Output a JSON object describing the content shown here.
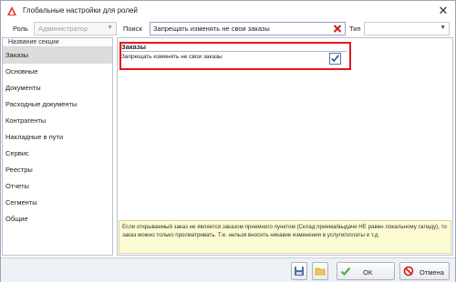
{
  "window": {
    "title": "Глобальные настройки для ролей",
    "close_glyph": "✕"
  },
  "filters": {
    "role_label": "Роль",
    "role_value": "Администратор",
    "search_label": "Поиск",
    "search_value": "Запрещать изменять не свои заказы",
    "type_label": "Тип",
    "type_value": ""
  },
  "sidebar": {
    "header": "Название секции",
    "items": [
      {
        "label": "Заказы",
        "selected": true
      },
      {
        "label": "Основные"
      },
      {
        "label": "Документы"
      },
      {
        "label": "Расходные документы"
      },
      {
        "label": "Контрагенты"
      },
      {
        "label": "Накладные в пути"
      },
      {
        "label": "Сервис"
      },
      {
        "label": "Реестры"
      },
      {
        "label": "Отчеты"
      },
      {
        "label": "Сегменты"
      },
      {
        "label": "Общие"
      }
    ]
  },
  "settings": {
    "group_title": "Заказы",
    "option_label": "Запрещать изменять не свои заказы",
    "option_checked": true,
    "description": "Если открываемый заказ не является заказом приемного пунктом (Склад приема/выдачи НЕ равен локальному складу), то заказ можно только просматривать. Т.е. нельзя вносить никакие изменения в услуги/оплаты и т.д."
  },
  "buttons": {
    "ok": "ОК",
    "cancel": "Отмена"
  },
  "colors": {
    "highlight": "#e4161c",
    "selected_bg": "#dcdcdc",
    "description_bg": "#fdfbd2",
    "ok_check": "#4caf50",
    "cancel_icon": "#d21c1c"
  },
  "icons": [
    "app-logo-icon",
    "close-icon",
    "chevron-down-icon",
    "clear-icon",
    "checkbox-icon",
    "save-icon",
    "folder-icon",
    "checkmark-icon",
    "cancel-icon"
  ]
}
